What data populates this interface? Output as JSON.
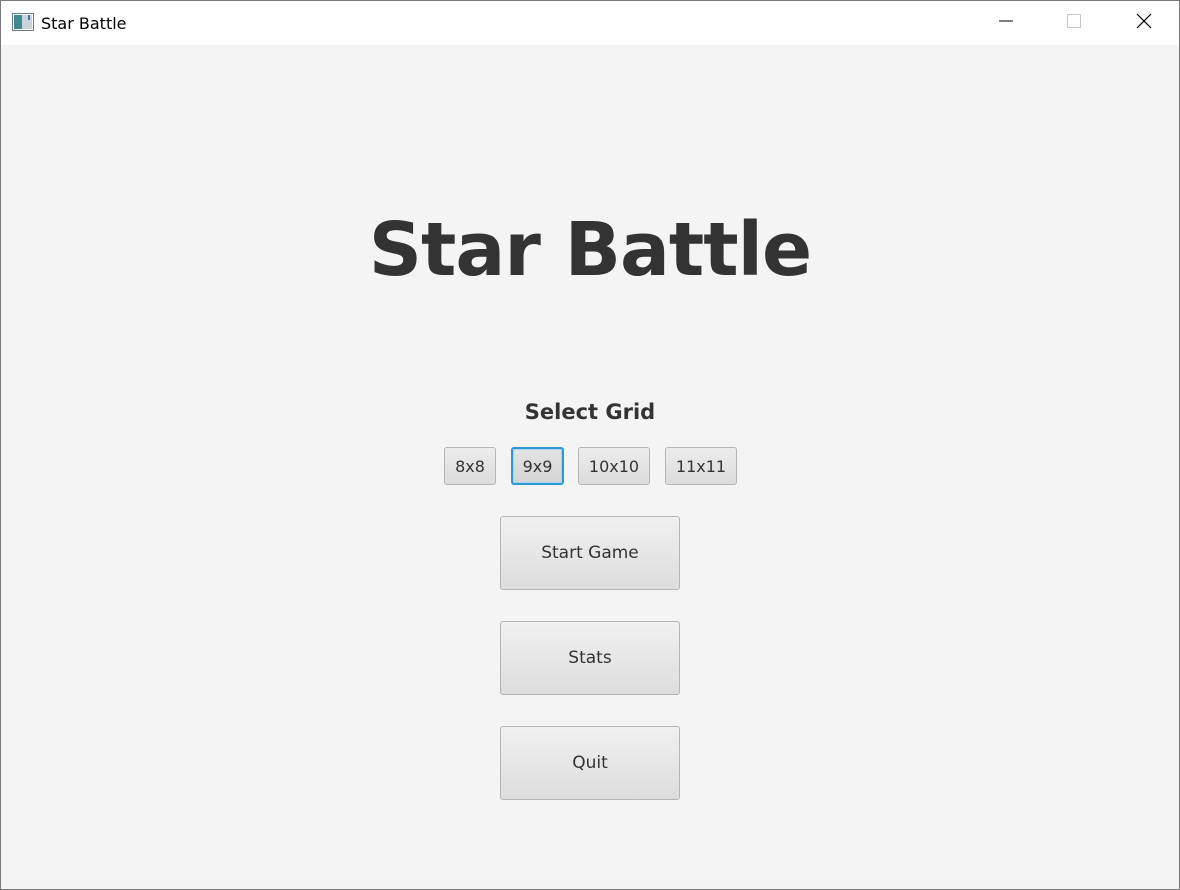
{
  "window": {
    "title": "Star Battle",
    "icons": {
      "app": "app-window-icon",
      "minimize": "minimize-icon",
      "maximize": "maximize-icon",
      "close": "close-icon"
    }
  },
  "main": {
    "title": "Star Battle",
    "grid_label": "Select Grid",
    "grid_options": [
      "8x8",
      "9x9",
      "10x10",
      "11x11"
    ],
    "selected_grid": "9x9",
    "buttons": {
      "start": "Start Game",
      "stats": "Stats",
      "quit": "Quit"
    }
  },
  "colors": {
    "background": "#f4f4f4",
    "text": "#333333",
    "focus_accent": "#2a9ad6"
  }
}
